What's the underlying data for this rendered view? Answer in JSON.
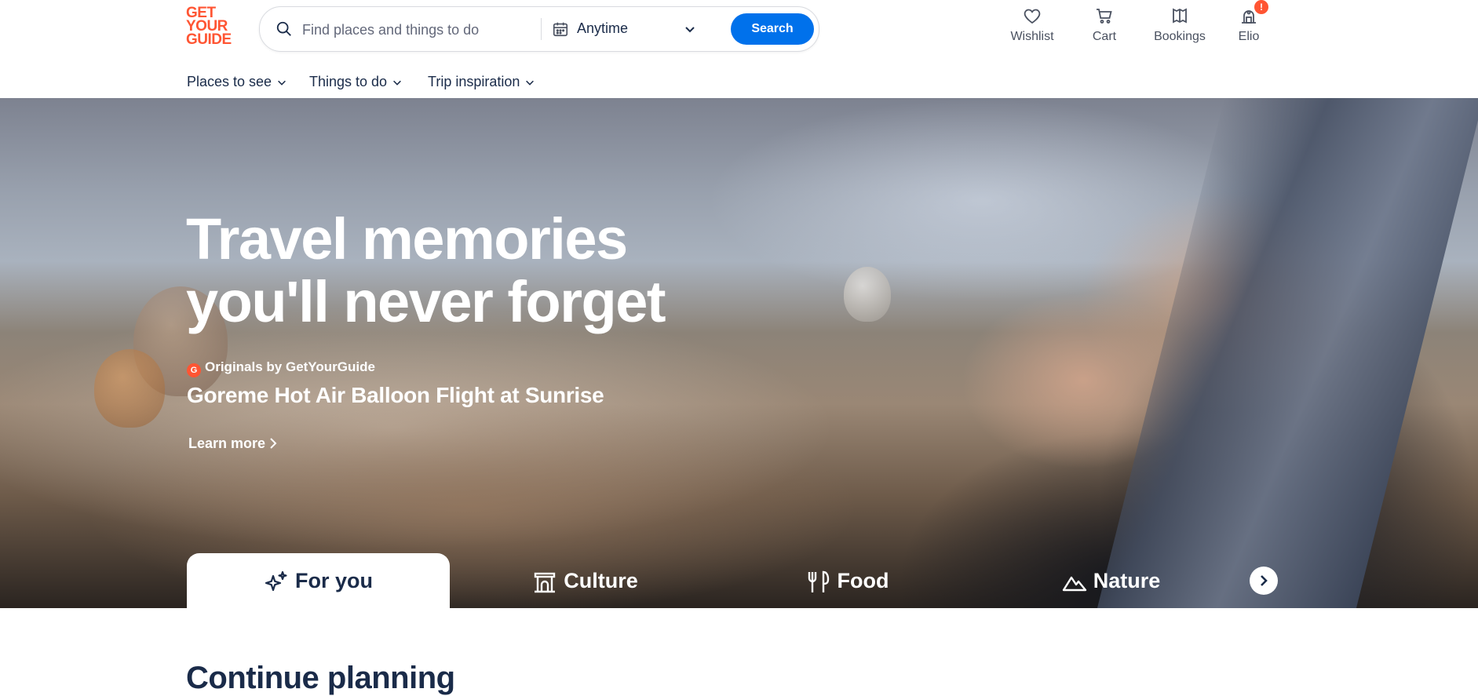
{
  "brand": {
    "logo_lines": [
      "GET",
      "YOUR",
      "GUIDE"
    ],
    "color": "#ff5533"
  },
  "search": {
    "placeholder": "Find places and things to do",
    "date_label": "Anytime",
    "button_label": "Search",
    "button_color": "#0071eb"
  },
  "nav_actions": [
    {
      "label": "Wishlist",
      "icon": "heart-icon"
    },
    {
      "label": "Cart",
      "icon": "cart-icon"
    },
    {
      "label": "Bookings",
      "icon": "bookmark-ticket-icon"
    },
    {
      "label": "Elio",
      "icon": "user-icon",
      "badge": "!"
    }
  ],
  "menu": [
    {
      "label": "Places to see"
    },
    {
      "label": "Things to do"
    },
    {
      "label": "Trip inspiration"
    }
  ],
  "hero": {
    "title_line1": "Travel memories",
    "title_line2": "you'll never forget",
    "originals_badge": "G",
    "originals_label": "Originals by GetYourGuide",
    "feature_title": "Goreme Hot Air Balloon Flight at Sunrise",
    "cta_label": "Learn more"
  },
  "categories": [
    {
      "label": "For you",
      "icon": "sparkle-icon",
      "active": true
    },
    {
      "label": "Culture",
      "icon": "monument-icon",
      "active": false
    },
    {
      "label": "Food",
      "icon": "fork-knife-icon",
      "active": false
    },
    {
      "label": "Nature",
      "icon": "mountain-icon",
      "active": false
    }
  ],
  "sections": {
    "continue_planning": "Continue planning"
  }
}
